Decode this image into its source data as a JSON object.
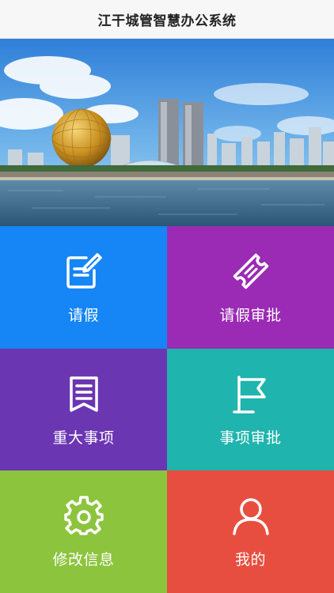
{
  "header": {
    "title": "江干城管智慧办公系统"
  },
  "banner": {
    "icon": "city-skyline-photo"
  },
  "menu": [
    {
      "label": "请假",
      "icon": "edit-note-icon",
      "color": "#1685f5"
    },
    {
      "label": "请假审批",
      "icon": "ticket-icon",
      "color": "#9b2bb4"
    },
    {
      "label": "重大事项",
      "icon": "document-bookmark-icon",
      "color": "#6a36b2"
    },
    {
      "label": "事项审批",
      "icon": "flag-icon",
      "color": "#1fb4ad"
    },
    {
      "label": "修改信息",
      "icon": "gear-icon",
      "color": "#8cc43e"
    },
    {
      "label": "我的",
      "icon": "user-icon",
      "color": "#e84e3f"
    }
  ]
}
